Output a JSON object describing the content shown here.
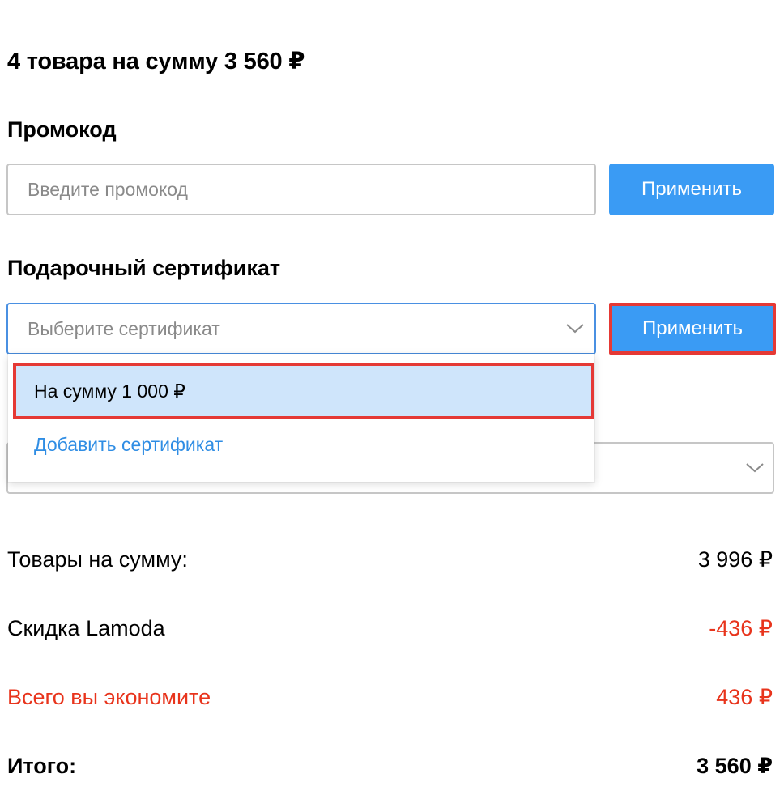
{
  "summary": {
    "title": "4 товара на сумму 3 560 ₽"
  },
  "promo": {
    "heading": "Промокод",
    "placeholder": "Введите промокод",
    "apply_label": "Применить"
  },
  "certificate": {
    "heading": "Подарочный сертификат",
    "placeholder": "Выберите сертификат",
    "apply_label": "Применить",
    "options": [
      {
        "label": "На сумму 1 000 ₽"
      },
      {
        "label": "Добавить сертификат"
      }
    ]
  },
  "totals": {
    "rows": [
      {
        "label": "Товары на сумму:",
        "value": "3 996 ₽"
      },
      {
        "label": "Скидка Lamoda",
        "value": "-436 ₽"
      },
      {
        "label": "Всего вы экономите",
        "value": "436 ₽"
      },
      {
        "label": "Итого:",
        "value": "3 560 ₽"
      }
    ]
  },
  "colors": {
    "accent": "#3a9bf4",
    "highlight": "#e53935",
    "discount": "#e8341c",
    "selected_option_bg": "#cfe5fb"
  }
}
